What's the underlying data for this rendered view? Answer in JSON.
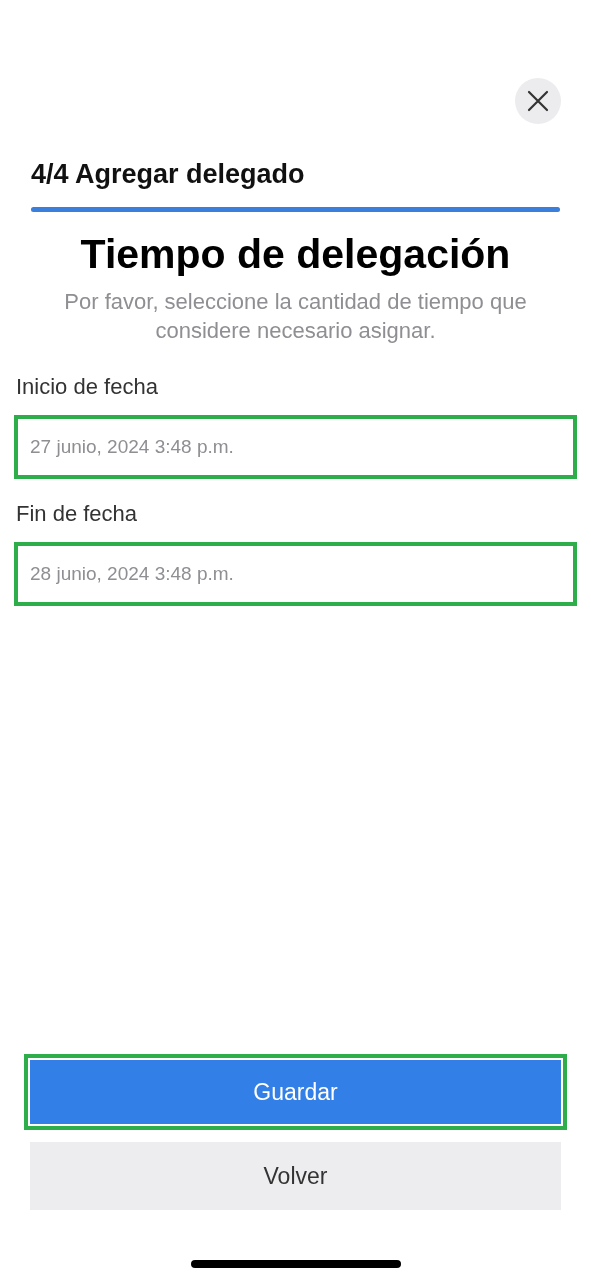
{
  "header": {
    "title": "4/4 Agregar delegado",
    "progress": {
      "level": 1
    }
  },
  "heading": "Tiempo de delegación",
  "description": "Por favor, seleccione la cantidad de tiempo que considere necesario asignar.",
  "fields": [
    {
      "label": "Inicio de fecha",
      "value": "27 junio, 2024 3:48 p.m.",
      "highlighted": true
    },
    {
      "label": "Fin de fecha",
      "value": "28 junio, 2024 3:48 p.m.",
      "highlighted": true
    }
  ],
  "buttons": [
    {
      "label": "Guardar",
      "kind": "primary",
      "highlighted": true
    },
    {
      "label": "Volver",
      "kind": "secondary",
      "highlighted": false
    }
  ]
}
